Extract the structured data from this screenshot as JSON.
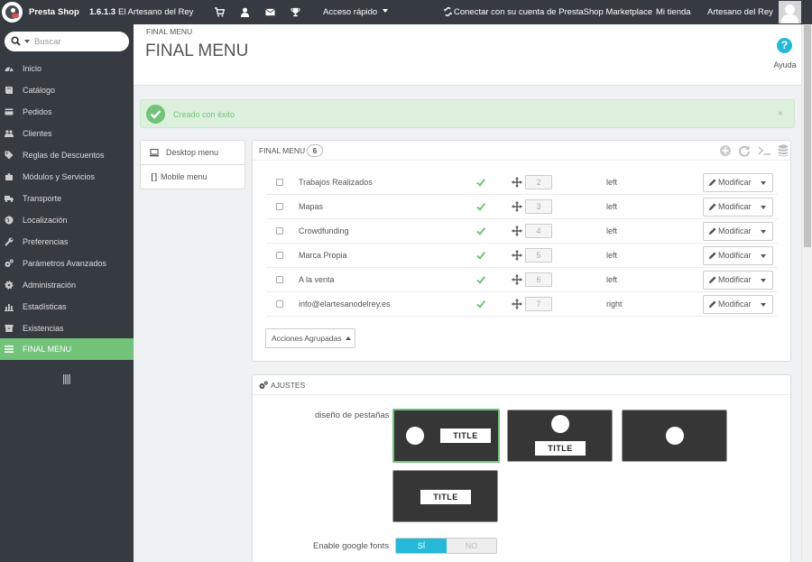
{
  "topbar": {
    "brand_presta": "Presta",
    "brand_shop": "Shop",
    "version": "1.6.1.3",
    "shop_name": "El Artesano del Rey",
    "quick_access": "Acceso rápido",
    "marketplace": "Conectar con su cuenta de PrestaShop Marketplace",
    "my_shop": "Mi tienda",
    "employee": "Artesano del Rey"
  },
  "search": {
    "placeholder": "Buscar"
  },
  "sidebar": {
    "items": [
      {
        "label": "Inicio",
        "icon": "dashboard-icon"
      },
      {
        "label": "Catálogo",
        "icon": "book-icon"
      },
      {
        "label": "Pedidos",
        "icon": "credit-card-icon"
      },
      {
        "label": "Clientes",
        "icon": "users-icon"
      },
      {
        "label": "Reglas de Descuentos",
        "icon": "tags-icon"
      },
      {
        "label": "Módulos y Servicios",
        "icon": "puzzle-icon"
      },
      {
        "label": "Transporte",
        "icon": "truck-icon"
      },
      {
        "label": "Localización",
        "icon": "globe-icon"
      },
      {
        "label": "Preferencias",
        "icon": "wrench-icon"
      },
      {
        "label": "Parámetros Avanzados",
        "icon": "cogs-icon"
      },
      {
        "label": "Administración",
        "icon": "gear-icon"
      },
      {
        "label": "Estadísticas",
        "icon": "bar-chart-icon"
      },
      {
        "label": "Existencias",
        "icon": "archive-icon"
      },
      {
        "label": "FINAL MENU",
        "icon": "menu-icon",
        "active": true
      }
    ]
  },
  "header": {
    "breadcrumb": "FINAL MENU",
    "title": "FINAL MENU",
    "help_label": "Ayuda",
    "help_glyph": "?"
  },
  "alert": {
    "message": "Creado con éxito",
    "close": "×"
  },
  "tabs": {
    "desktop": "Desktop menu",
    "mobile": "Mobile menu"
  },
  "menu_panel": {
    "title": "FINAL MENU",
    "count": "6",
    "rows": [
      {
        "label": "Trabajos Realizados",
        "position": "2",
        "align": "left",
        "edit": "Modificar"
      },
      {
        "label": "Mapas",
        "position": "3",
        "align": "left",
        "edit": "Modificar"
      },
      {
        "label": "Crowdfunding",
        "position": "4",
        "align": "left",
        "edit": "Modificar"
      },
      {
        "label": "Marca Propia",
        "position": "5",
        "align": "left",
        "edit": "Modificar"
      },
      {
        "label": "A la venta",
        "position": "6",
        "align": "left",
        "edit": "Modificar"
      },
      {
        "label": "info@elartesanodelrey.es",
        "position": "7",
        "align": "right",
        "edit": "Modificar"
      }
    ],
    "bulk_actions": "Acciones Agrupadas"
  },
  "settings": {
    "title": "AJUSTES",
    "tab_design_label": "diseño de pestañas",
    "layout_title_text": "TITLE",
    "google_fonts_label": "Enable google fonts",
    "yes": "SÍ",
    "no": "NO"
  },
  "colors": {
    "topbar_bg": "#363a41",
    "accent_green": "#72c279",
    "accent_blue": "#25b9d7",
    "brand_pink": "#df0067"
  }
}
